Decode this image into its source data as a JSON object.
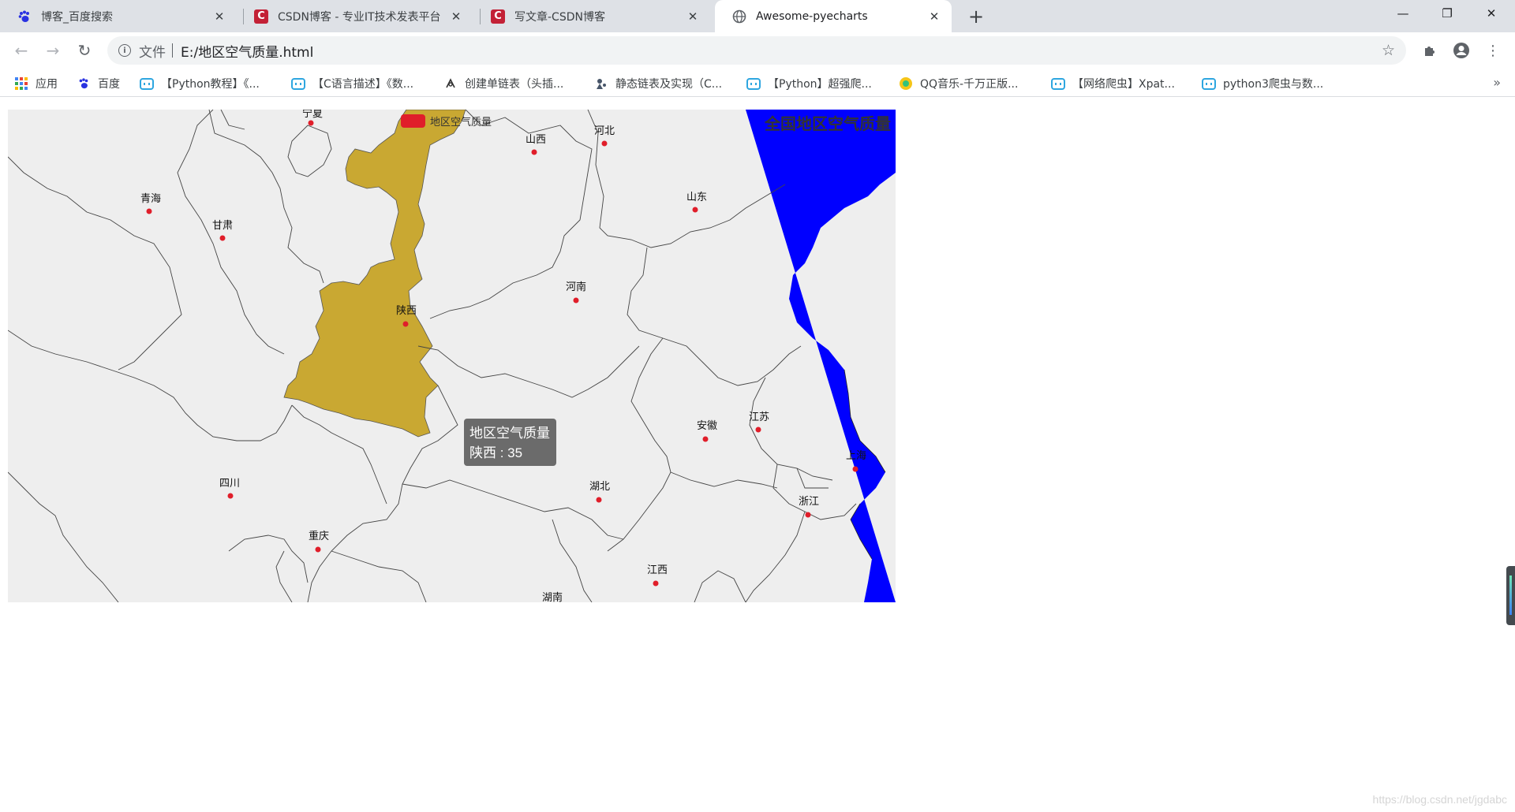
{
  "browser": {
    "tabs": [
      {
        "title": "博客_百度搜索",
        "icon": "baidu-paw-icon"
      },
      {
        "title": "CSDN博客 - 专业IT技术发表平台",
        "icon": "csdn-logo-icon"
      },
      {
        "title": "写文章-CSDN博客",
        "icon": "csdn-logo-icon"
      },
      {
        "title": "Awesome-pyecharts",
        "icon": "globe-icon",
        "active": true
      }
    ],
    "address": {
      "scheme_label": "文件",
      "url": "E:/地区空气质量.html"
    },
    "bookmarks": [
      {
        "label": "应用",
        "icon": "apps-grid-icon"
      },
      {
        "label": "百度",
        "icon": "baidu-paw-icon"
      },
      {
        "label": "【Python教程】《...",
        "icon": "bilibili-icon"
      },
      {
        "label": "【C语言描述】《数...",
        "icon": "bilibili-icon"
      },
      {
        "label": "创建单链表（头插...",
        "icon": "link-bookmark-icon"
      },
      {
        "label": "静态链表及实现（C...",
        "icon": "link-bookmark-icon"
      },
      {
        "label": "【Python】超强爬...",
        "icon": "bilibili-icon"
      },
      {
        "label": "QQ音乐-千万正版...",
        "icon": "qqmusic-icon"
      },
      {
        "label": "【网络爬虫】Xpat...",
        "icon": "bilibili-icon"
      },
      {
        "label": "python3爬虫与数...",
        "icon": "bilibili-icon"
      }
    ]
  },
  "page": {
    "chart_title": "全国地区空气质量",
    "legend_label": "地区空气质量",
    "tooltip": {
      "series": "地区空气质量",
      "text": "陕西 : 35"
    },
    "watermark": "https://blog.csdn.net/jgdabc"
  },
  "colors": {
    "highlight": "#c9a832",
    "sea": "#0000ff",
    "land": "#eeeeee",
    "dot": "#e01e2a"
  },
  "chart_data": {
    "type": "map",
    "title": "全国地区空气质量",
    "series": [
      {
        "name": "地区空气质量",
        "data": [
          {
            "region": "陕西",
            "value": 35
          }
        ]
      }
    ],
    "labels": [
      "宁夏",
      "山西",
      "河北",
      "青海",
      "甘肃",
      "山东",
      "河南",
      "陕西",
      "安徽",
      "江苏",
      "上海",
      "四川",
      "湖北",
      "浙江",
      "重庆",
      "江西",
      "湖南"
    ]
  }
}
